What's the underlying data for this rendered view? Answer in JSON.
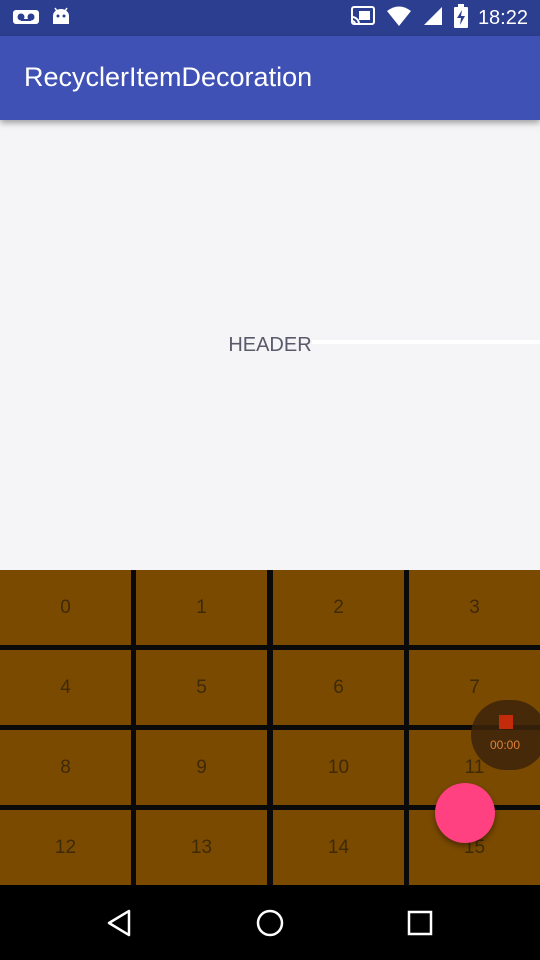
{
  "status_bar": {
    "time": "18:22",
    "icons": [
      "voicemail-icon",
      "android-icon",
      "cast-icon",
      "wifi-icon",
      "signal-icon",
      "battery-charging-icon"
    ]
  },
  "app_bar": {
    "title": "RecyclerItemDecoration"
  },
  "header": {
    "label": "HEADER"
  },
  "grid": {
    "items": [
      "0",
      "1",
      "2",
      "3",
      "4",
      "5",
      "6",
      "7",
      "8",
      "9",
      "10",
      "11",
      "12",
      "13",
      "14",
      "15"
    ],
    "colors": {
      "cell": "#7a4a00",
      "divider": "#0a0a0a",
      "text": "#3e2a08"
    }
  },
  "recorder": {
    "time": "00:00"
  },
  "fab": {
    "color": "#ff4081"
  },
  "nav_bar": {
    "buttons": [
      "back-icon",
      "home-icon",
      "recents-icon"
    ]
  },
  "colors": {
    "primary": "#3f51b5",
    "status_bar": "#2c3e8f",
    "background": "#f5f5f7"
  }
}
